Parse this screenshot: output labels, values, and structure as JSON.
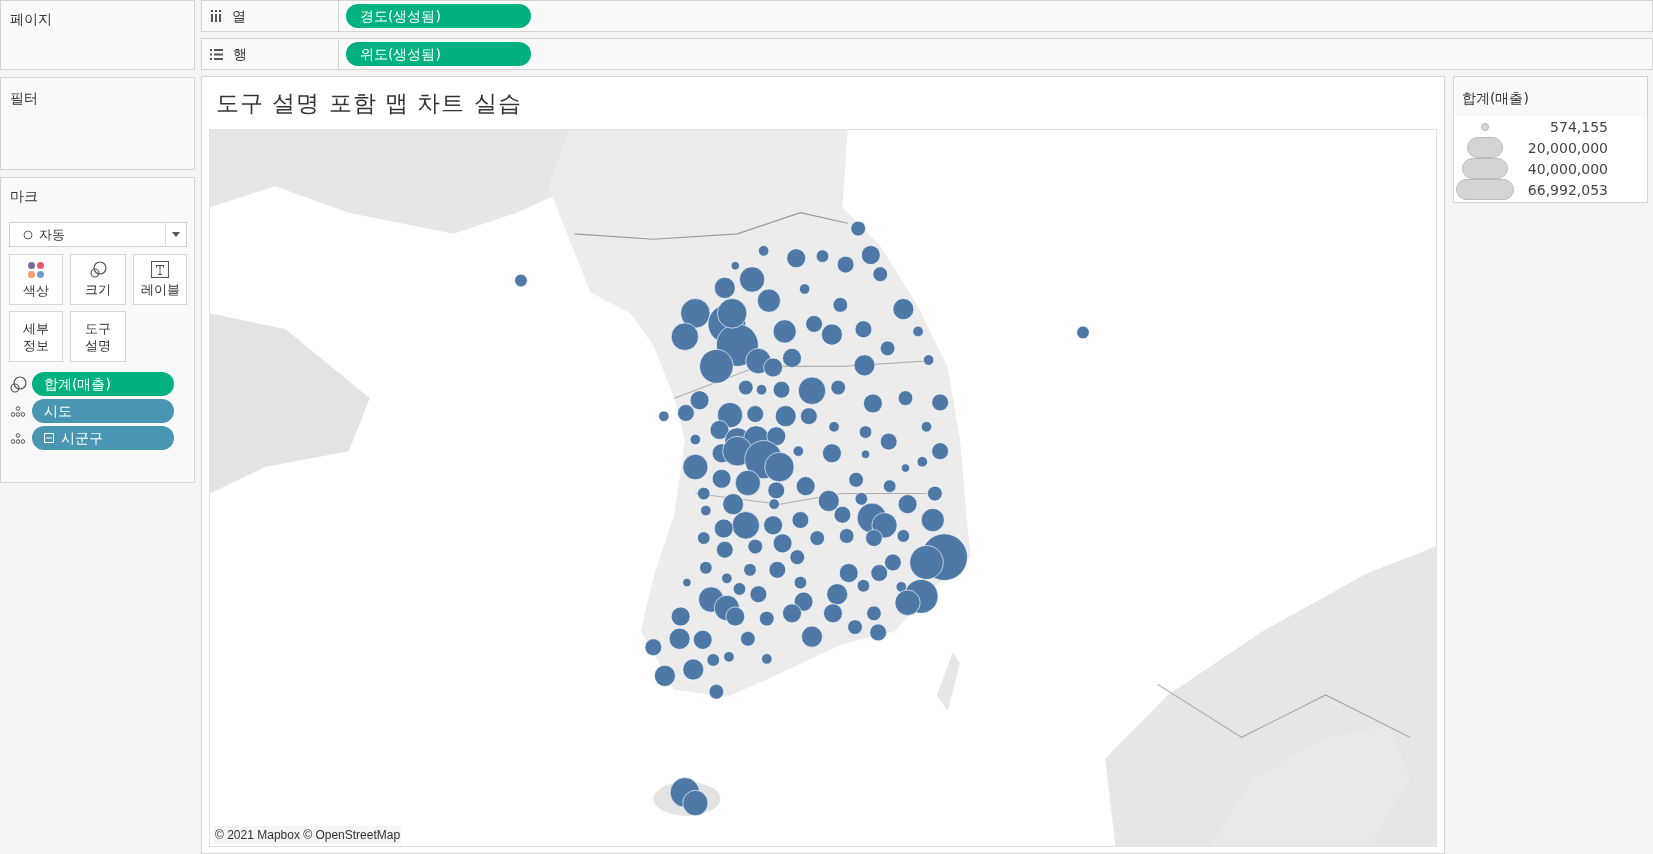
{
  "pages_shelf": {
    "title": "페이지"
  },
  "shelves": [
    {
      "kind": "columns",
      "label": "열",
      "pill": "경도(생성됨)"
    },
    {
      "kind": "rows",
      "label": "행",
      "pill": "위도(생성됨)"
    }
  ],
  "filters_shelf": {
    "title": "필터"
  },
  "marks": {
    "title": "마크",
    "mark_type": "자동",
    "cards": [
      {
        "kind": "color",
        "label": "색상"
      },
      {
        "kind": "size",
        "label": "크기"
      },
      {
        "kind": "label",
        "label": "레이블"
      },
      {
        "kind": "detail",
        "label": "세부\n정보"
      },
      {
        "kind": "tooltip",
        "label": "도구\n설명"
      }
    ],
    "fields": [
      {
        "kind": "size",
        "label": "합계(매출)",
        "color": "#00b180"
      },
      {
        "kind": "detail",
        "label": "시도",
        "color": "#4996b2"
      },
      {
        "kind": "detail",
        "label": "시군구",
        "color": "#4996b2",
        "expanded": true
      }
    ]
  },
  "view": {
    "title": "도구 설명 포함 맵 차트 실습",
    "attribution": "© 2021 Mapbox © OpenStreetMap"
  },
  "legend": {
    "title": "합계(매출)",
    "items": [
      "574,155",
      "20,000,000",
      "40,000,000",
      "66,992,053"
    ]
  }
}
